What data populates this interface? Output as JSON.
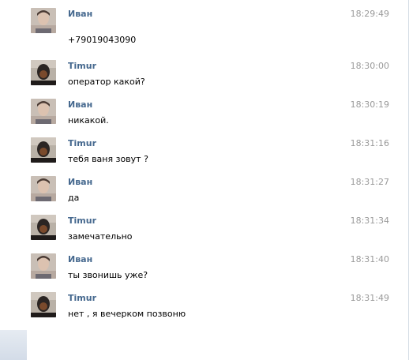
{
  "users": {
    "ivan": "Иван",
    "timur": "Timur"
  },
  "messages": [
    {
      "author": "Иван",
      "avatar": "ivan-avatar",
      "time": "18:29:49",
      "text": "+79019043090"
    },
    {
      "author": "Timur",
      "avatar": "timur-avatar",
      "time": "18:30:00",
      "text": "оператор какой?"
    },
    {
      "author": "Иван",
      "avatar": "ivan-avatar",
      "time": "18:30:19",
      "text": "никакой."
    },
    {
      "author": "Timur",
      "avatar": "timur-avatar",
      "time": "18:31:16",
      "text": "тебя ваня зовут ?"
    },
    {
      "author": "Иван",
      "avatar": "ivan-avatar",
      "time": "18:31:27",
      "text": "да"
    },
    {
      "author": "Timur",
      "avatar": "timur-avatar",
      "time": "18:31:34",
      "text": "замечательно"
    },
    {
      "author": "Иван",
      "avatar": "ivan-avatar",
      "time": "18:31:40",
      "text": "ты звонишь уже?"
    },
    {
      "author": "Timur",
      "avatar": "timur-avatar",
      "time": "18:31:49",
      "text": "нет , я вечерком позвоню"
    }
  ],
  "colors": {
    "author_link": "#45688e",
    "timestamp": "#999999",
    "message_text": "#000000"
  }
}
